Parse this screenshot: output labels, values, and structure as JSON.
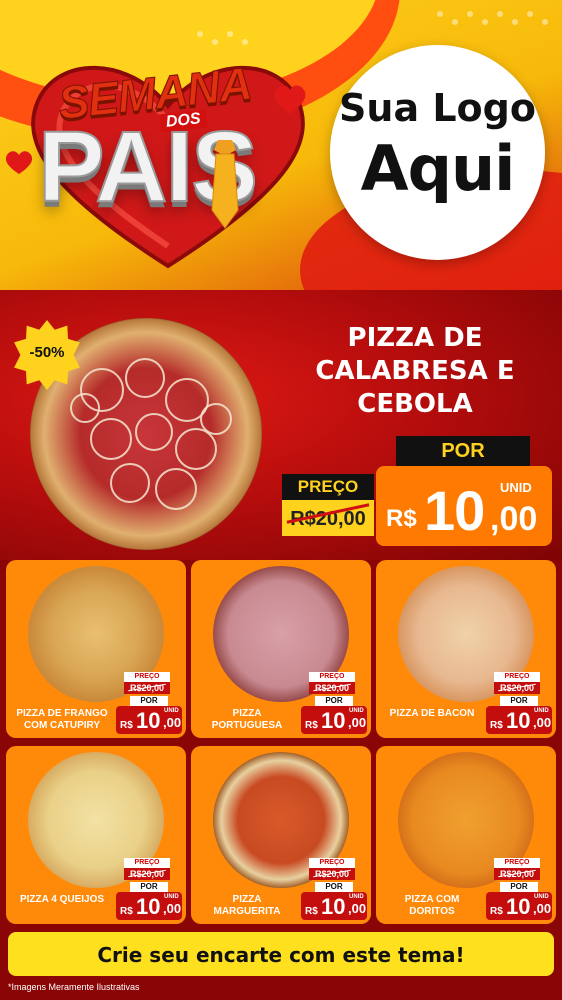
{
  "header": {
    "title_line1": "SEMANA",
    "title_dos": "DOS",
    "title_line2": "PAIS",
    "logo_line1": "Sua Logo",
    "logo_line2": "Aqui",
    "colors": {
      "yellow": "#ffd21e",
      "red": "#d21010",
      "orange": "#ff7a00"
    }
  },
  "featured": {
    "discount": "-50%",
    "name_lines": [
      "PIZZA DE",
      "CALABRESA E",
      "CEBOLA"
    ],
    "preco_label": "PREÇO",
    "old_price": "R$20,00",
    "por_label": "POR",
    "currency": "R$",
    "price_int": "10",
    "price_dec": ",00",
    "unit": "UNID"
  },
  "products": [
    {
      "name_l1": "PIZZA DE FRANGO",
      "name_l2": "COM CATUPIRY",
      "preco": "PREÇO",
      "old": "R$20,00",
      "por": "POR",
      "rs": "R$",
      "int": "10",
      "dec": ",00",
      "unid": "UNID",
      "pizza_icon": "pizza-frango-catupiry-icon"
    },
    {
      "name_l1": "PIZZA",
      "name_l2": "PORTUGUESA",
      "preco": "PREÇO",
      "old": "R$20,00",
      "por": "POR",
      "rs": "R$",
      "int": "10",
      "dec": ",00",
      "unid": "UNID",
      "pizza_icon": "pizza-portuguesa-icon"
    },
    {
      "name_l1": "",
      "name_l2": "PIZZA DE BACON",
      "preco": "PREÇO",
      "old": "R$20,00",
      "por": "POR",
      "rs": "R$",
      "int": "10",
      "dec": ",00",
      "unid": "UNID",
      "pizza_icon": "pizza-bacon-icon"
    },
    {
      "name_l1": "",
      "name_l2": "PIZZA 4 QUEIJOS",
      "preco": "PREÇO",
      "old": "R$20,00",
      "por": "POR",
      "rs": "R$",
      "int": "10",
      "dec": ",00",
      "unid": "UNID",
      "pizza_icon": "pizza-4-queijos-icon"
    },
    {
      "name_l1": "PIZZA",
      "name_l2": "MARGUERITA",
      "preco": "PREÇO",
      "old": "R$20,00",
      "por": "POR",
      "rs": "R$",
      "int": "10",
      "dec": ",00",
      "unid": "UNID",
      "pizza_icon": "pizza-marguerita-icon"
    },
    {
      "name_l1": "PIZZA COM",
      "name_l2": "DORITOS",
      "preco": "PREÇO",
      "old": "R$20,00",
      "por": "POR",
      "rs": "R$",
      "int": "10",
      "dec": ",00",
      "unid": "UNID",
      "pizza_icon": "pizza-doritos-icon"
    }
  ],
  "footer": {
    "cta": "Crie seu encarte com este tema!",
    "disclaimer": "*Imagens Meramente Ilustrativas"
  }
}
